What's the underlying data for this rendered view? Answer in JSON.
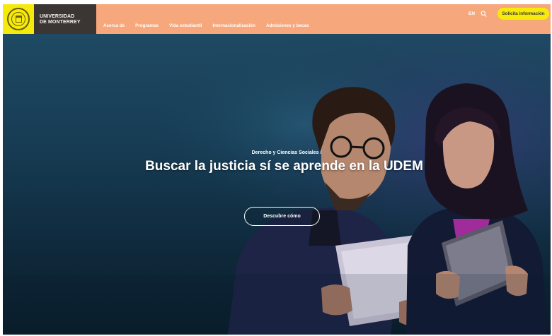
{
  "header": {
    "brand": {
      "line1": "UNIVERSIDAD",
      "line2": "DE MONTERREY"
    },
    "nav": [
      {
        "label": "Acerca de"
      },
      {
        "label": "Programas"
      },
      {
        "label": "Vida estudiantil"
      },
      {
        "label": "Internacionalización"
      },
      {
        "label": "Admisiones y becas"
      }
    ],
    "lang": "EN",
    "search_icon": "search-icon",
    "cta_label": "Solicita información"
  },
  "hero": {
    "kicker": "Derecho y Ciencias Sociales /",
    "title": "Buscar la justicia sí se aprende en la UDEM",
    "button_label": "Descubre cómo"
  },
  "colors": {
    "brand_yellow": "#f6ea0b",
    "brand_dark": "#3b3533",
    "nav_orange": "#f6a77b",
    "hero_blue": "#173d55"
  }
}
